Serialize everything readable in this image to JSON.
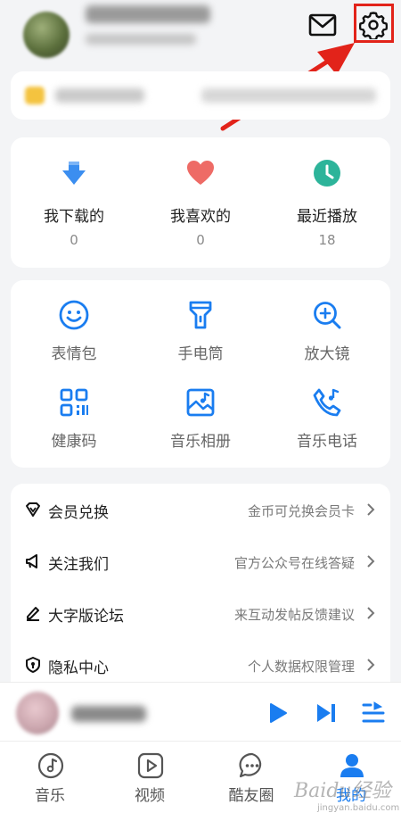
{
  "header": {
    "mail_icon": "mail-icon",
    "settings_icon": "gear-icon",
    "highlight_color": "#e2231a"
  },
  "stats": [
    {
      "label": "我下载的",
      "count": "0",
      "icon": "download-icon"
    },
    {
      "label": "我喜欢的",
      "count": "0",
      "icon": "heart-icon"
    },
    {
      "label": "最近播放",
      "count": "18",
      "icon": "clock-icon"
    }
  ],
  "tools": [
    {
      "label": "表情包",
      "icon": "smiley-icon"
    },
    {
      "label": "手电筒",
      "icon": "flashlight-icon"
    },
    {
      "label": "放大镜",
      "icon": "magnifier-plus-icon"
    },
    {
      "label": "健康码",
      "icon": "qr-code-icon"
    },
    {
      "label": "音乐相册",
      "icon": "photo-album-icon"
    },
    {
      "label": "音乐电话",
      "icon": "music-phone-icon"
    }
  ],
  "menu": [
    {
      "title": "会员兑换",
      "subtitle": "金币可兑换会员卡",
      "icon": "vip-diamond-icon"
    },
    {
      "title": "关注我们",
      "subtitle": "官方公众号在线答疑",
      "icon": "megaphone-icon"
    },
    {
      "title": "大字版论坛",
      "subtitle": "来互动发帖反馈建议",
      "icon": "pencil-icon"
    },
    {
      "title": "隐私中心",
      "subtitle": "个人数据权限管理",
      "icon": "shield-icon"
    }
  ],
  "tabs": [
    {
      "label": "音乐",
      "icon": "music-disc-icon"
    },
    {
      "label": "视频",
      "icon": "video-play-icon"
    },
    {
      "label": "酷友圈",
      "icon": "chat-bubble-icon"
    },
    {
      "label": "我的",
      "icon": "user-icon"
    }
  ],
  "watermark": {
    "text": "Baidu经验",
    "sub": "jingyan.baidu.com"
  },
  "colors": {
    "accent": "#1a7df0",
    "heart": "#ee6b66",
    "clock": "#2db49a",
    "download": "#3b8ef0"
  }
}
